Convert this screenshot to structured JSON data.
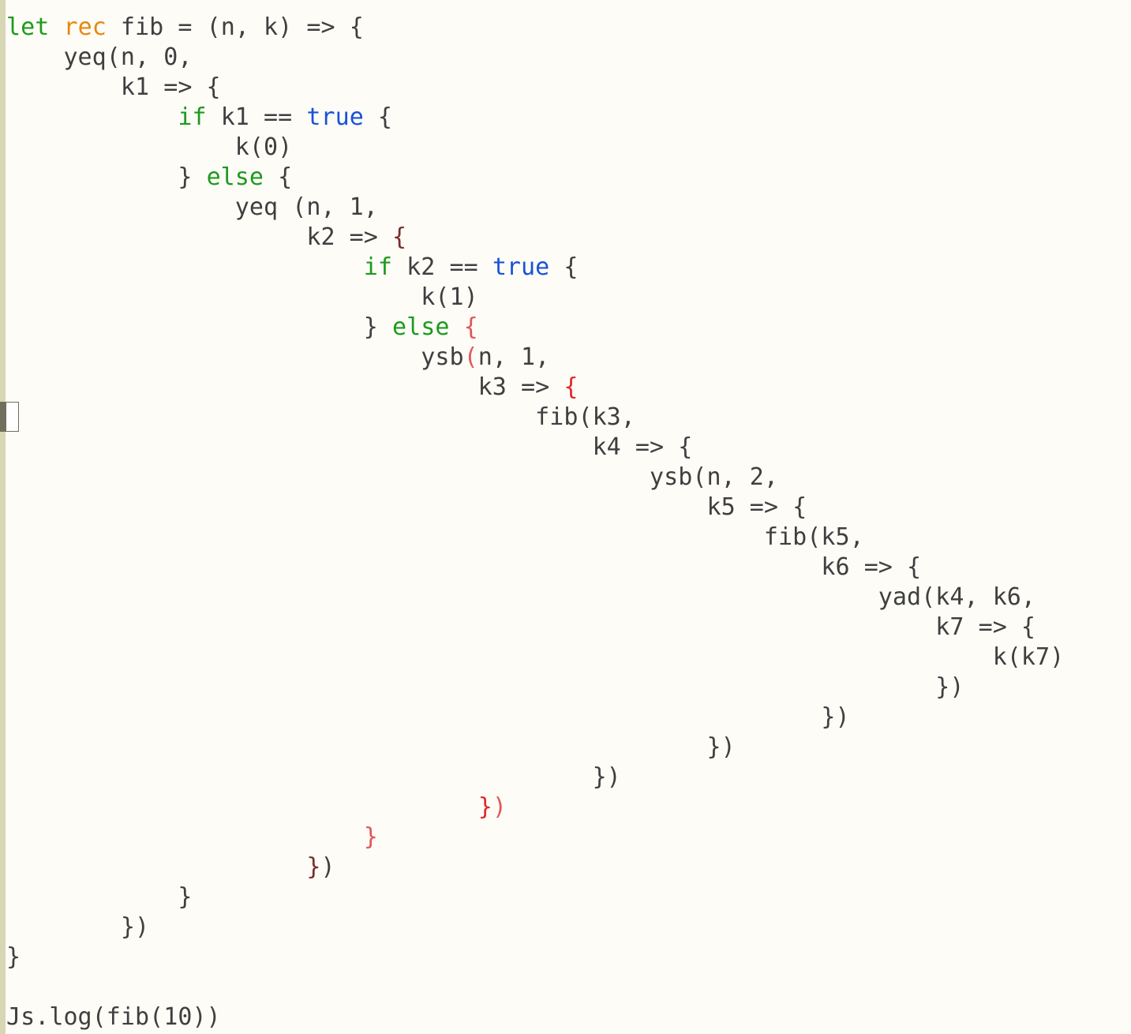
{
  "editor": {
    "colors": {
      "background": "#fdfcf7",
      "gutter": "#d8d6b4",
      "text": "#3f3f3f",
      "keyword": "#1e9a1e",
      "rec_keyword": "#e8870e",
      "boolean": "#1a52d8",
      "brace_level_dark": "#7a2e2e",
      "brace_level_red": "#e02a2a",
      "brace_level_pink": "#e0585a"
    },
    "code_lines": [
      [
        [
          "keyword",
          "let"
        ],
        [
          "plain",
          " "
        ],
        [
          "rec",
          "rec"
        ],
        [
          "plain",
          " fib = (n, k) => {"
        ]
      ],
      [
        [
          "plain",
          "    yeq(n, 0,"
        ]
      ],
      [
        [
          "plain",
          "        k1 => {"
        ]
      ],
      [
        [
          "plain",
          "            "
        ],
        [
          "keyword",
          "if"
        ],
        [
          "plain",
          " k1 == "
        ],
        [
          "bool",
          "true"
        ],
        [
          "plain",
          " {"
        ]
      ],
      [
        [
          "plain",
          "                k(0)"
        ]
      ],
      [
        [
          "plain",
          "            } "
        ],
        [
          "keyword",
          "else"
        ],
        [
          "plain",
          " {"
        ]
      ],
      [
        [
          "plain",
          "                yeq (n, 1,"
        ]
      ],
      [
        [
          "plain",
          "                     k2 => "
        ],
        [
          "brace-dark",
          "{"
        ]
      ],
      [
        [
          "plain",
          "                         "
        ],
        [
          "keyword",
          "if"
        ],
        [
          "plain",
          " k2 == "
        ],
        [
          "bool",
          "true"
        ],
        [
          "plain",
          " {"
        ]
      ],
      [
        [
          "plain",
          "                             k(1)"
        ]
      ],
      [
        [
          "plain",
          "                         } "
        ],
        [
          "keyword",
          "else"
        ],
        [
          "plain",
          " "
        ],
        [
          "brace-pink",
          "{"
        ]
      ],
      [
        [
          "plain",
          "                             ysb"
        ],
        [
          "brace-pink",
          "("
        ],
        [
          "plain",
          "n, 1,"
        ]
      ],
      [
        [
          "plain",
          "                                 k3 => "
        ],
        [
          "brace-red",
          "{"
        ]
      ],
      [
        [
          "plain",
          "                                     fib(k3,"
        ]
      ],
      [
        [
          "plain",
          "                                         k4 => {"
        ]
      ],
      [
        [
          "plain",
          "                                             ysb(n, 2,"
        ]
      ],
      [
        [
          "plain",
          "                                                 k5 => {"
        ]
      ],
      [
        [
          "plain",
          "                                                     fib(k5,"
        ]
      ],
      [
        [
          "plain",
          "                                                         k6 => {"
        ]
      ],
      [
        [
          "plain",
          "                                                             yad(k4, k6,"
        ]
      ],
      [
        [
          "plain",
          "                                                                 k7 => {"
        ]
      ],
      [
        [
          "plain",
          "                                                                     k(k7)"
        ]
      ],
      [
        [
          "plain",
          "                                                                 })"
        ]
      ],
      [
        [
          "plain",
          "                                                         })"
        ]
      ],
      [
        [
          "plain",
          "                                                 })"
        ]
      ],
      [
        [
          "plain",
          "                                         })"
        ]
      ],
      [
        [
          "plain",
          "                                 "
        ],
        [
          "brace-red",
          "}"
        ],
        [
          "brace-pink",
          ")"
        ]
      ],
      [
        [
          "plain",
          "                         "
        ],
        [
          "brace-pink",
          "}"
        ]
      ],
      [
        [
          "plain",
          "                     "
        ],
        [
          "brace-dark",
          "}"
        ],
        [
          "plain",
          ")"
        ]
      ],
      [
        [
          "plain",
          "            }"
        ]
      ],
      [
        [
          "plain",
          "        })"
        ]
      ],
      [
        [
          "plain",
          "}"
        ]
      ],
      [
        [
          "plain",
          ""
        ]
      ],
      [
        [
          "plain",
          "Js.log(fib(10))"
        ]
      ]
    ]
  }
}
